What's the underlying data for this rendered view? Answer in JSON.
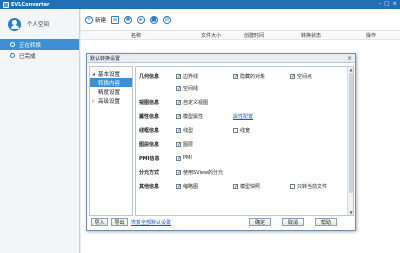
{
  "app": {
    "title": "EVLConverter"
  },
  "sidebar": {
    "user_label": "个人空间",
    "items": [
      {
        "label": "正在转换"
      },
      {
        "label": "已完成"
      }
    ]
  },
  "toolbar": {
    "new_label": "新建"
  },
  "columns": {
    "name": "名称",
    "size": "文件大小",
    "created": "创建时间",
    "status": "转换状态",
    "action": "操作"
  },
  "dialog": {
    "title": "默认转换设置",
    "tree": {
      "basic": "基本设置",
      "convert": "转换内容",
      "precision": "精度设置",
      "advanced": "高级设置"
    },
    "categories": {
      "geometry": "几何信息",
      "view": "视图信息",
      "property": "属性信息",
      "linetype": "线框信息",
      "layer": "图层信息",
      "pmi": "PMI信息",
      "sep": "分元方式",
      "other": "其他信息"
    },
    "options": {
      "edges": "边界线",
      "hidden": "隐藏的对象",
      "points": "空间点",
      "spacelines": "空间线",
      "custom_view": "自定义视图",
      "model_attr": "模型属性",
      "attr_config": "属性配置",
      "linetype": "线型",
      "linewidth": "线宽",
      "layer": "图层",
      "pmi": "PMI",
      "sview": "使用SView的分元",
      "thumbnail": "缩略图",
      "model_snapshot": "模型快照",
      "current_file": "只转当前文件"
    },
    "buttons": {
      "import": "导入",
      "export": "导出",
      "reset": "恢复全部默认设置",
      "ok": "确定",
      "cancel": "取消",
      "help": "帮助"
    }
  },
  "colors": {
    "accent": "#3d8fd6",
    "titlebar": "#1f6fb5"
  }
}
